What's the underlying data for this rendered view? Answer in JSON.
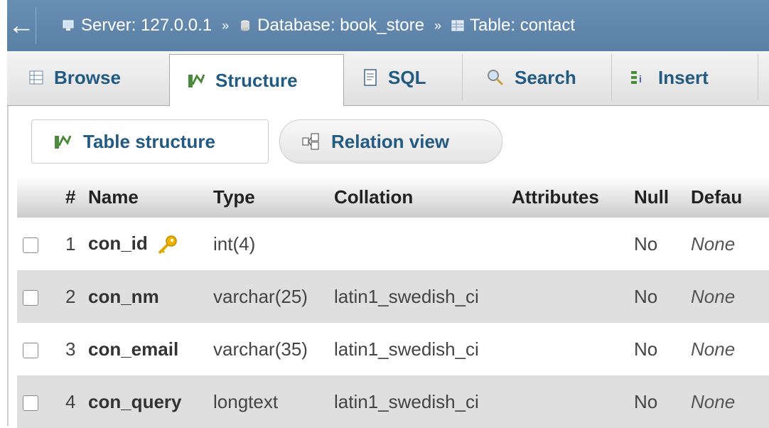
{
  "breadcrumb": {
    "back_symbol": "←",
    "server": "Server: 127.0.0.1",
    "database": "Database: book_store",
    "table": "Table: contact",
    "separator": "»"
  },
  "tabs": [
    {
      "label": "Browse",
      "icon": "browse-icon",
      "active": false
    },
    {
      "label": "Structure",
      "icon": "structure-icon",
      "active": true
    },
    {
      "label": "SQL",
      "icon": "sql-icon",
      "active": false
    },
    {
      "label": "Search",
      "icon": "search-icon",
      "active": false
    },
    {
      "label": "Insert",
      "icon": "insert-icon",
      "active": false
    }
  ],
  "subtabs": {
    "table_structure": "Table structure",
    "relation_view": "Relation view"
  },
  "table": {
    "headers": [
      "#",
      "Name",
      "Type",
      "Collation",
      "Attributes",
      "Null",
      "Defau"
    ],
    "rows": [
      {
        "num": "1",
        "name": "con_id",
        "type": "int(4)",
        "collation": "",
        "attributes": "",
        "null": "No",
        "default": "None",
        "primary_key": true
      },
      {
        "num": "2",
        "name": "con_nm",
        "type": "varchar(25)",
        "collation": "latin1_swedish_ci",
        "attributes": "",
        "null": "No",
        "default": "None",
        "primary_key": false
      },
      {
        "num": "3",
        "name": "con_email",
        "type": "varchar(35)",
        "collation": "latin1_swedish_ci",
        "attributes": "",
        "null": "No",
        "default": "None",
        "primary_key": false
      },
      {
        "num": "4",
        "name": "con_query",
        "type": "longtext",
        "collation": "latin1_swedish_ci",
        "attributes": "",
        "null": "No",
        "default": "None",
        "primary_key": false
      }
    ]
  },
  "colors": {
    "topbar": "#5a7fa5",
    "link": "#235a81",
    "row_alt": "#dfdfdf",
    "key": "#f0b400"
  }
}
